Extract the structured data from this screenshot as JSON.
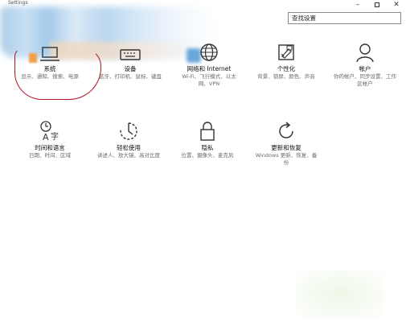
{
  "window": {
    "title": "Settings"
  },
  "search": {
    "value": "查找设置"
  },
  "items": [
    {
      "title": "系统",
      "desc": "显示、通知、搜索、电源",
      "icon": "laptop-icon"
    },
    {
      "title": "设备",
      "desc": "蓝牙、打印机、鼠标、键盘",
      "icon": "keyboard-icon"
    },
    {
      "title": "网络和 Internet",
      "desc": "Wi-Fi、飞行模式、以太网、VPN",
      "icon": "globe-icon"
    },
    {
      "title": "个性化",
      "desc": "背景、锁屏、颜色、声音",
      "icon": "paint-icon"
    },
    {
      "title": "帐户",
      "desc": "你的帐户、同步设置、工作区帐户",
      "icon": "person-icon"
    },
    {
      "title": "时间和语言",
      "desc": "日期、时间、区域",
      "icon": "time-language-icon"
    },
    {
      "title": "轻松使用",
      "desc": "讲述人、放大镜、高对比度",
      "icon": "ease-of-access-icon"
    },
    {
      "title": "隐私",
      "desc": "位置、摄像头、麦克风",
      "icon": "lock-icon"
    },
    {
      "title": "更新和恢复",
      "desc": "Windows 更新、恢复、备份",
      "icon": "refresh-icon"
    }
  ],
  "colors": {
    "annotation": "#b01020",
    "background": "#ffffff"
  }
}
